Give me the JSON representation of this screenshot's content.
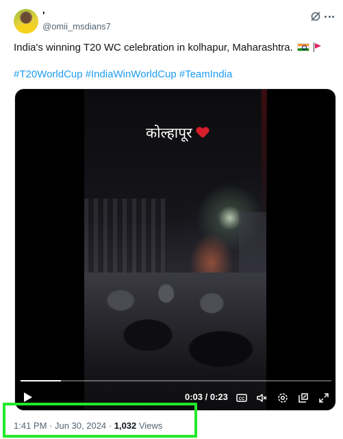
{
  "author": {
    "display_name": "'",
    "handle": "@omii_msdians7",
    "avatar_icon": "avatar-photo"
  },
  "header_icons": [
    "grok-icon",
    "more-icon"
  ],
  "tweet": {
    "text": "India's winning T20 WC celebration in kolhapur, Maharashtra.",
    "emojis": [
      "india-flag-icon",
      "triangular-flag-icon"
    ],
    "hashtags": [
      "#T20WorldCup",
      "#IndiaWinWorldCup",
      "#TeamIndia"
    ]
  },
  "video": {
    "caption": "कोल्हापूर",
    "caption_emoji": "heart-icon",
    "current_time": "0:03",
    "duration": "0:23",
    "time_separator": " / ",
    "progress": 0.13,
    "controls": [
      "play-icon",
      "captions-icon",
      "mute-icon",
      "settings-icon",
      "pop-out-icon",
      "fullscreen-icon"
    ]
  },
  "meta": {
    "time": "1:41 PM",
    "date": "Jun 30, 2024",
    "separator": " · ",
    "views_count": "1,032",
    "views_label": "Views"
  },
  "colors": {
    "accent": "#1d9bf0",
    "highlight": "#22e82a",
    "text": "#0f1419",
    "secondary": "#536471"
  }
}
